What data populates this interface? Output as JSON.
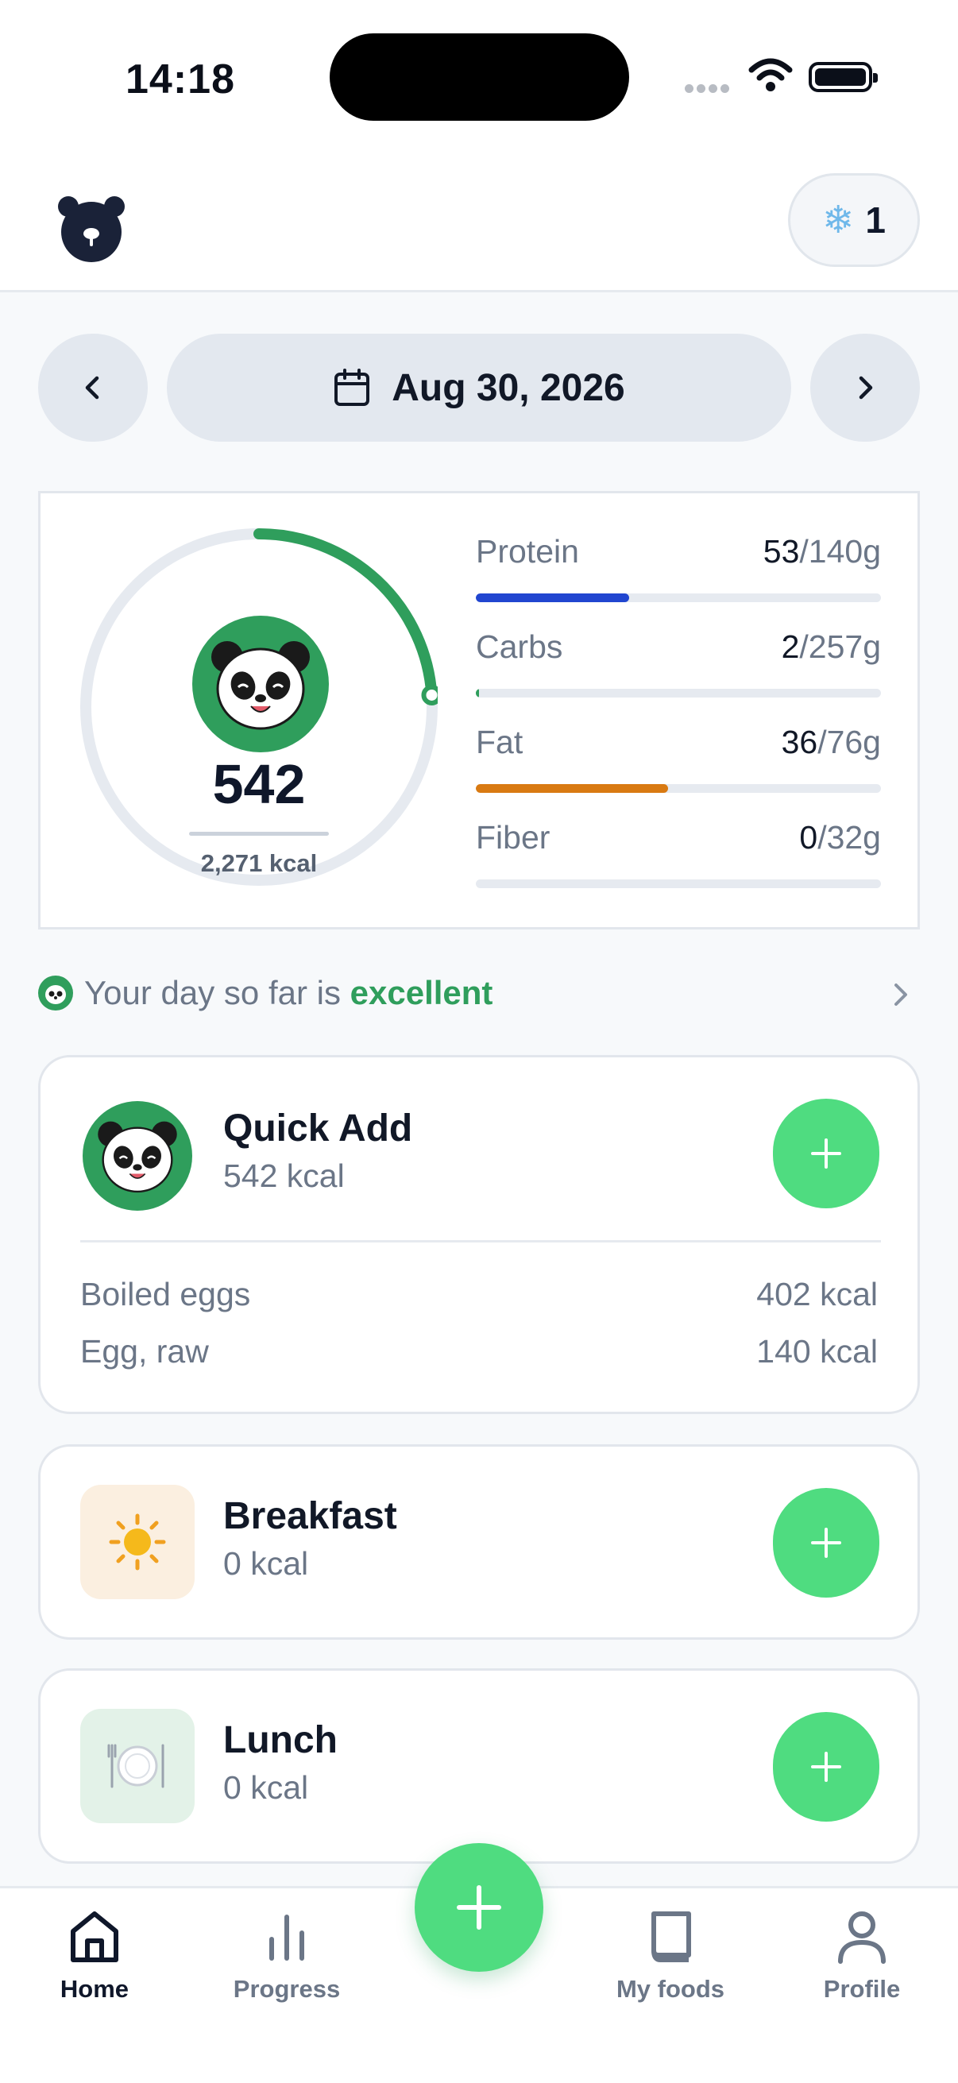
{
  "status_bar": {
    "time": "14:18"
  },
  "header": {
    "streak_count": "1",
    "streak_icon": "snowflake-icon"
  },
  "date_nav": {
    "date": "Aug 30, 2026"
  },
  "summary": {
    "calories_eaten": "542",
    "calorie_goal": "2,271 kcal",
    "calorie_progress": 0.239,
    "macros": [
      {
        "name": "Protein",
        "eaten": "53",
        "goal": "/140g",
        "progress": 0.379,
        "color": "#2146d0"
      },
      {
        "name": "Carbs",
        "eaten": "2",
        "goal": "/257g",
        "progress": 0.008,
        "color": "#2f9e5c"
      },
      {
        "name": "Fat",
        "eaten": "36",
        "goal": "/76g",
        "progress": 0.474,
        "color": "#d97a12"
      },
      {
        "name": "Fiber",
        "eaten": "0",
        "goal": "/32g",
        "progress": 0,
        "color": "#2f9e5c"
      }
    ]
  },
  "day_status": {
    "prefix": "Your day so far is ",
    "rating": "excellent"
  },
  "meals": {
    "quick_add": {
      "title": "Quick Add",
      "kcal": "542 kcal",
      "items": [
        {
          "name": "Boiled eggs",
          "kcal": "402 kcal"
        },
        {
          "name": "Egg, raw",
          "kcal": "140 kcal"
        }
      ]
    },
    "breakfast": {
      "title": "Breakfast",
      "kcal": "0 kcal",
      "icon": "sun-icon"
    },
    "lunch": {
      "title": "Lunch",
      "kcal": "0 kcal",
      "icon": "plate-icon"
    }
  },
  "tabbar": {
    "home": "Home",
    "progress": "Progress",
    "my_foods": "My foods",
    "profile": "Profile"
  },
  "colors": {
    "accent": "#4fdc80",
    "brand_green": "#2f9e5c"
  }
}
